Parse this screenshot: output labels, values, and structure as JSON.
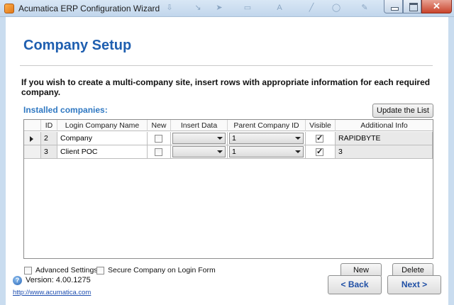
{
  "window": {
    "title": "Acumatica ERP Configuration Wizard",
    "close_glyph": "✕"
  },
  "page": {
    "heading": "Company Setup",
    "description": "If you wish to create a multi-company site, insert rows with appropriate information for each required company.",
    "installed_label": "Installed companies:",
    "update_button": "Update the List"
  },
  "grid": {
    "columns": [
      "ID",
      "Login Company Name",
      "New",
      "Insert Data",
      "Parent Company ID",
      "Visible",
      "Additional Info"
    ],
    "rows": [
      {
        "id": "2",
        "name": "Company",
        "new": false,
        "insert_data": "",
        "parent_id": "1",
        "visible": true,
        "info": "RAPIDBYTE",
        "current": true
      },
      {
        "id": "3",
        "name": "Client POC",
        "new": false,
        "insert_data": "",
        "parent_id": "1",
        "visible": true,
        "info": "3",
        "current": false
      }
    ]
  },
  "options": {
    "advanced_settings": "Advanced Settings",
    "secure_company": "Secure Company on Login Form"
  },
  "actions": {
    "new": "New",
    "delete": "Delete",
    "back": "< Back",
    "next": "Next >"
  },
  "footer": {
    "version": "Version:  4.00.1275",
    "url": "http://www.acumatica.com",
    "help_glyph": "?"
  },
  "colors": {
    "heading": "#1f5fb0",
    "section_label": "#2f78c2",
    "frame": "#c9dcef"
  }
}
